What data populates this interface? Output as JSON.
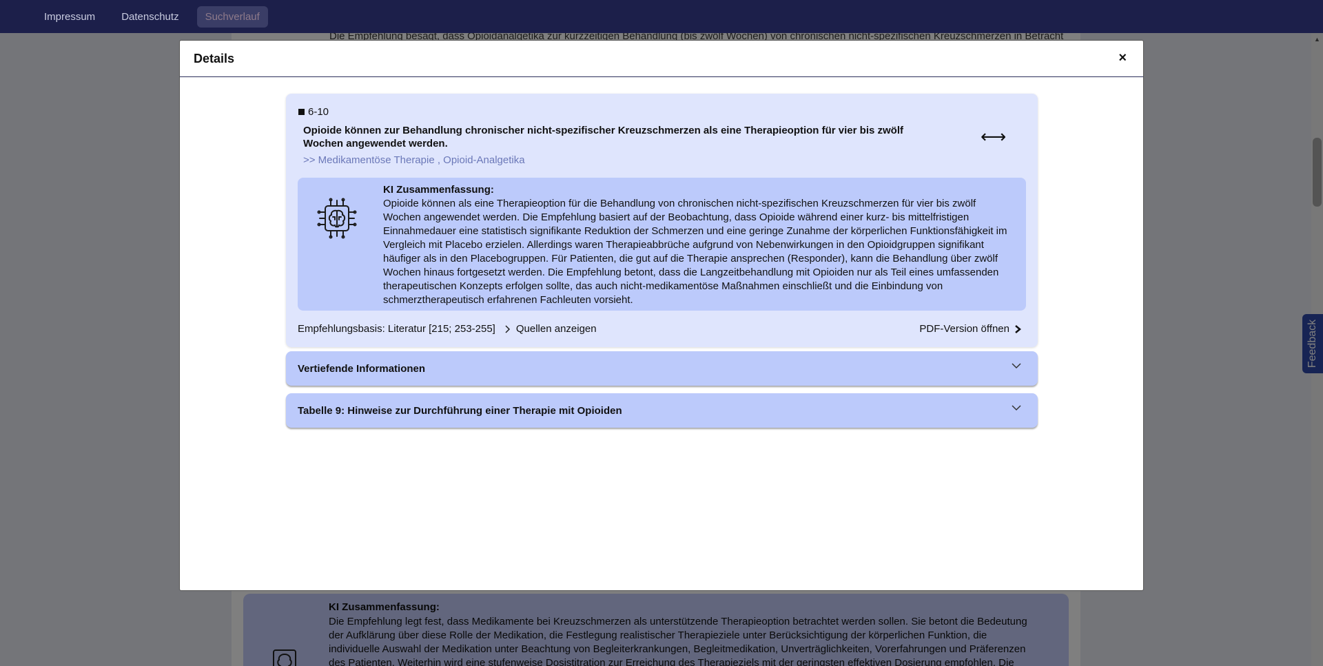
{
  "nav": {
    "items": [
      "Impressum",
      "Datenschutz",
      "Suchverlauf"
    ]
  },
  "background": {
    "top_text": "Die Empfehlung besagt, dass Opioidanalgetika zur kurzzeitigen Behandlung (bis zwölf Wochen) von chronischen nicht-spezifischen Kreuzschmerzen in Betracht",
    "ki_title": "KI Zusammenfassung:",
    "ki_text": "Die Empfehlung legt fest, dass Medikamente bei Kreuzschmerzen als unterstützende Therapieoption betrachtet werden sollen. Sie betont die Bedeutung der Aufklärung über diese Rolle der Medikation, die Festlegung realistischer Therapieziele unter Berücksichtigung der körperlichen Funktion, die individuelle Auswahl der Medikation unter Beachtung von Begleiterkrankungen, Begleitmedikation, Unverträglichkeiten, Vorerfahrungen und Präferenzen des Patienten. Weiterhin wird eine stufenweise Dosistitration zur Erreichung des Therapieziels mit der geringsten effektiven Dosierung empfohlen. Die Überprüfung von"
  },
  "feedback": {
    "label": "Feedback"
  },
  "modal": {
    "title": "Details",
    "close_label": "×",
    "recommendation": {
      "id": "6-10",
      "text": "Opioide können zur Behandlung chronischer nicht-spezifischer Kreuzschmerzen als eine Therapieoption für vier bis zwölf Wochen angewendet werden.",
      "arrow_symbol": "⟷",
      "breadcrumb": ">> Medikamentöse Therapie , Opioid-Analgetika"
    },
    "ki": {
      "title": "KI Zusammenfassung:",
      "text": "Opioide können als eine Therapieoption für die Behandlung von chronischen nicht-spezifischen Kreuzschmerzen für vier bis zwölf Wochen angewendet werden. Die Empfehlung basiert auf der Beobachtung, dass Opioide während einer kurz- bis mittelfristigen Einnahmedauer eine statistisch signifikante Reduktion der Schmerzen und eine geringe Zunahme der körperlichen Funktionsfähigkeit im Vergleich mit Placebo erzielen. Allerdings waren Therapieabbrüche aufgrund von Nebenwirkungen in den Opioidgruppen signifikant häufiger als in den Placebogruppen. Für Patienten, die gut auf die Therapie ansprechen (Responder), kann die Behandlung über zwölf Wochen hinaus fortgesetzt werden. Die Empfehlung betont, dass die Langzeitbehandlung mit Opioiden nur als Teil eines umfassenden therapeutischen Konzepts erfolgen sollte, das auch nicht-medikamentöse Maßnahmen einschließt und die Einbindung von schmerztherapeutisch erfahrenen Fachleuten vorsieht."
    },
    "footer": {
      "basis": "Empfehlungsbasis: Literatur [215; 253-255]",
      "sources_label": "Quellen anzeigen",
      "pdf_label": "PDF-Version öffnen"
    },
    "accordions": [
      {
        "label": "Vertiefende Informationen"
      },
      {
        "label": "Tabelle 9: Hinweise zur Durchführung einer Therapie mit Opioiden"
      }
    ]
  },
  "icons": {
    "brain": "brain-chip-icon",
    "chevron_right": "chevron-right-icon",
    "chevron_down": "chevron-down-icon",
    "arrow": "double-arrow-icon"
  }
}
